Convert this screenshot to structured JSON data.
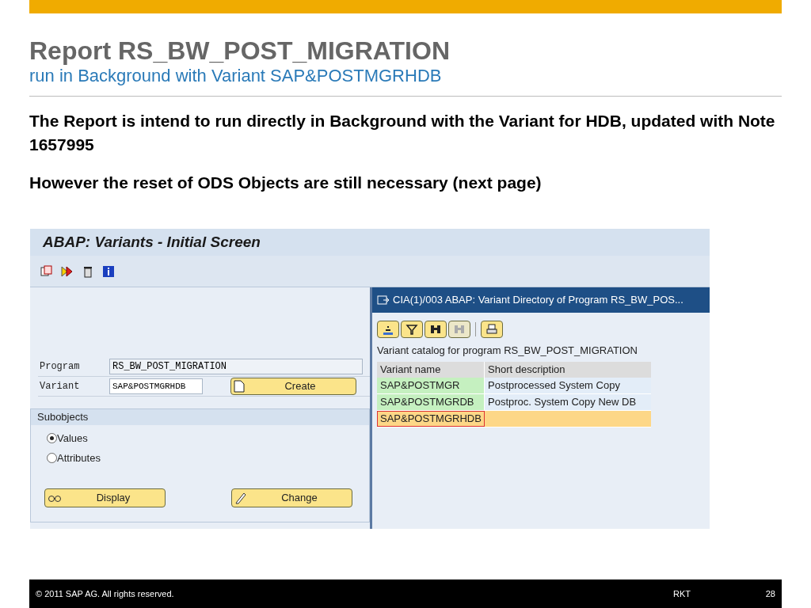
{
  "slide": {
    "title": "Report RS_BW_POST_MIGRATION",
    "subtitle": "run in Background with Variant SAP&POSTMGRHDB",
    "paragraphs": [
      "The Report is intend to run directly in Background with the Variant for HDB, updated with Note 1657995",
      "However the reset of ODS Objects are still necessary (next page)"
    ]
  },
  "sap_window": {
    "title": "ABAP: Variants - Initial Screen",
    "fields": [
      {
        "label": "Program",
        "value": "RS_BW_POST_MIGRATION"
      },
      {
        "label": "Variant",
        "value": "SAP&POSTMGRHDB"
      }
    ],
    "create_button": "Create",
    "subobjects": {
      "title": "Subobjects",
      "options": [
        {
          "label": "Values",
          "selected": true
        },
        {
          "label": "Attributes",
          "selected": false
        }
      ]
    },
    "buttons": [
      {
        "kind": "display",
        "label": "Display"
      },
      {
        "kind": "change",
        "label": "Change"
      }
    ]
  },
  "popup": {
    "title": "CIA(1)/003 ABAP: Variant Directory of Program RS_BW_POS...",
    "caption": "Variant catalog for program RS_BW_POST_MIGRATION",
    "columns": [
      "Variant name",
      "Short description"
    ],
    "rows": [
      {
        "name": "SAP&POSTMGR",
        "description": "Postprocessed System Copy",
        "selected": false
      },
      {
        "name": "SAP&POSTMGRDB",
        "description": "Postproc. System Copy New DB",
        "selected": false
      },
      {
        "name": "SAP&POSTMGRHDB",
        "selected": true
      }
    ]
  },
  "footer": {
    "copyright": "© 2011 SAP AG. All rights reserved.",
    "author": "RKT",
    "page": "28"
  }
}
